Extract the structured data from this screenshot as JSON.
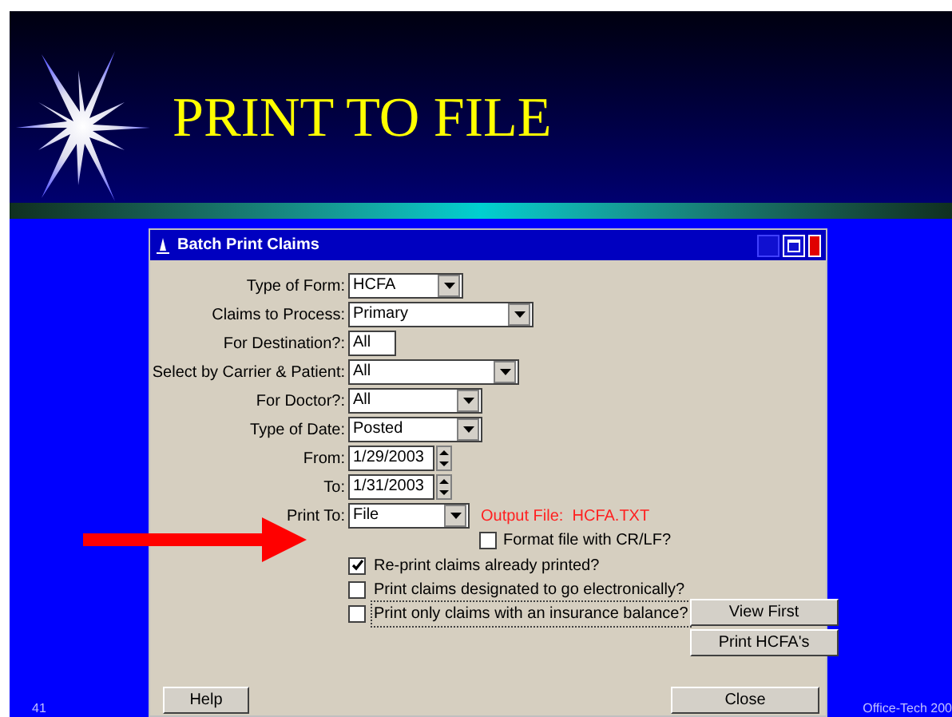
{
  "slide": {
    "title": "PRINT TO FILE",
    "page_number": "41",
    "footer": "Office-Tech 200"
  },
  "dialog": {
    "title": "Batch Print Claims",
    "fields": [
      {
        "label": "Type of Form:",
        "kind": "dropdown",
        "value": "HCFA"
      },
      {
        "label": "Claims to Process:",
        "kind": "dropdown",
        "value": "Primary"
      },
      {
        "label": "For Destination?:",
        "kind": "text",
        "value": "All"
      },
      {
        "label": "Select by Carrier & Patient:",
        "kind": "dropdown",
        "value": "All"
      },
      {
        "label": "For Doctor?:",
        "kind": "dropdown",
        "value": "All"
      },
      {
        "label": "Type of Date:",
        "kind": "dropdown",
        "value": "Posted"
      },
      {
        "label": "From:",
        "kind": "spin",
        "value": "1/29/2003"
      },
      {
        "label": "To:",
        "kind": "spin",
        "value": "1/31/2003"
      },
      {
        "label": "Print To:",
        "kind": "dropdown",
        "value": "File"
      }
    ],
    "output_file": "Output File:  HCFA.TXT",
    "format_option": {
      "label": "Format file with CR/LF?",
      "checked": false
    },
    "options": [
      {
        "label": "Re-print claims already printed?",
        "checked": true,
        "focused": false
      },
      {
        "label": "Print claims designated to go electronically?",
        "checked": false,
        "focused": false
      },
      {
        "label": "Print only claims with an insurance balance?",
        "checked": false,
        "focused": true
      }
    ],
    "side_buttons": [
      "View First",
      "Print HCFA's"
    ],
    "help_button": "Help",
    "close_button": "Close"
  }
}
